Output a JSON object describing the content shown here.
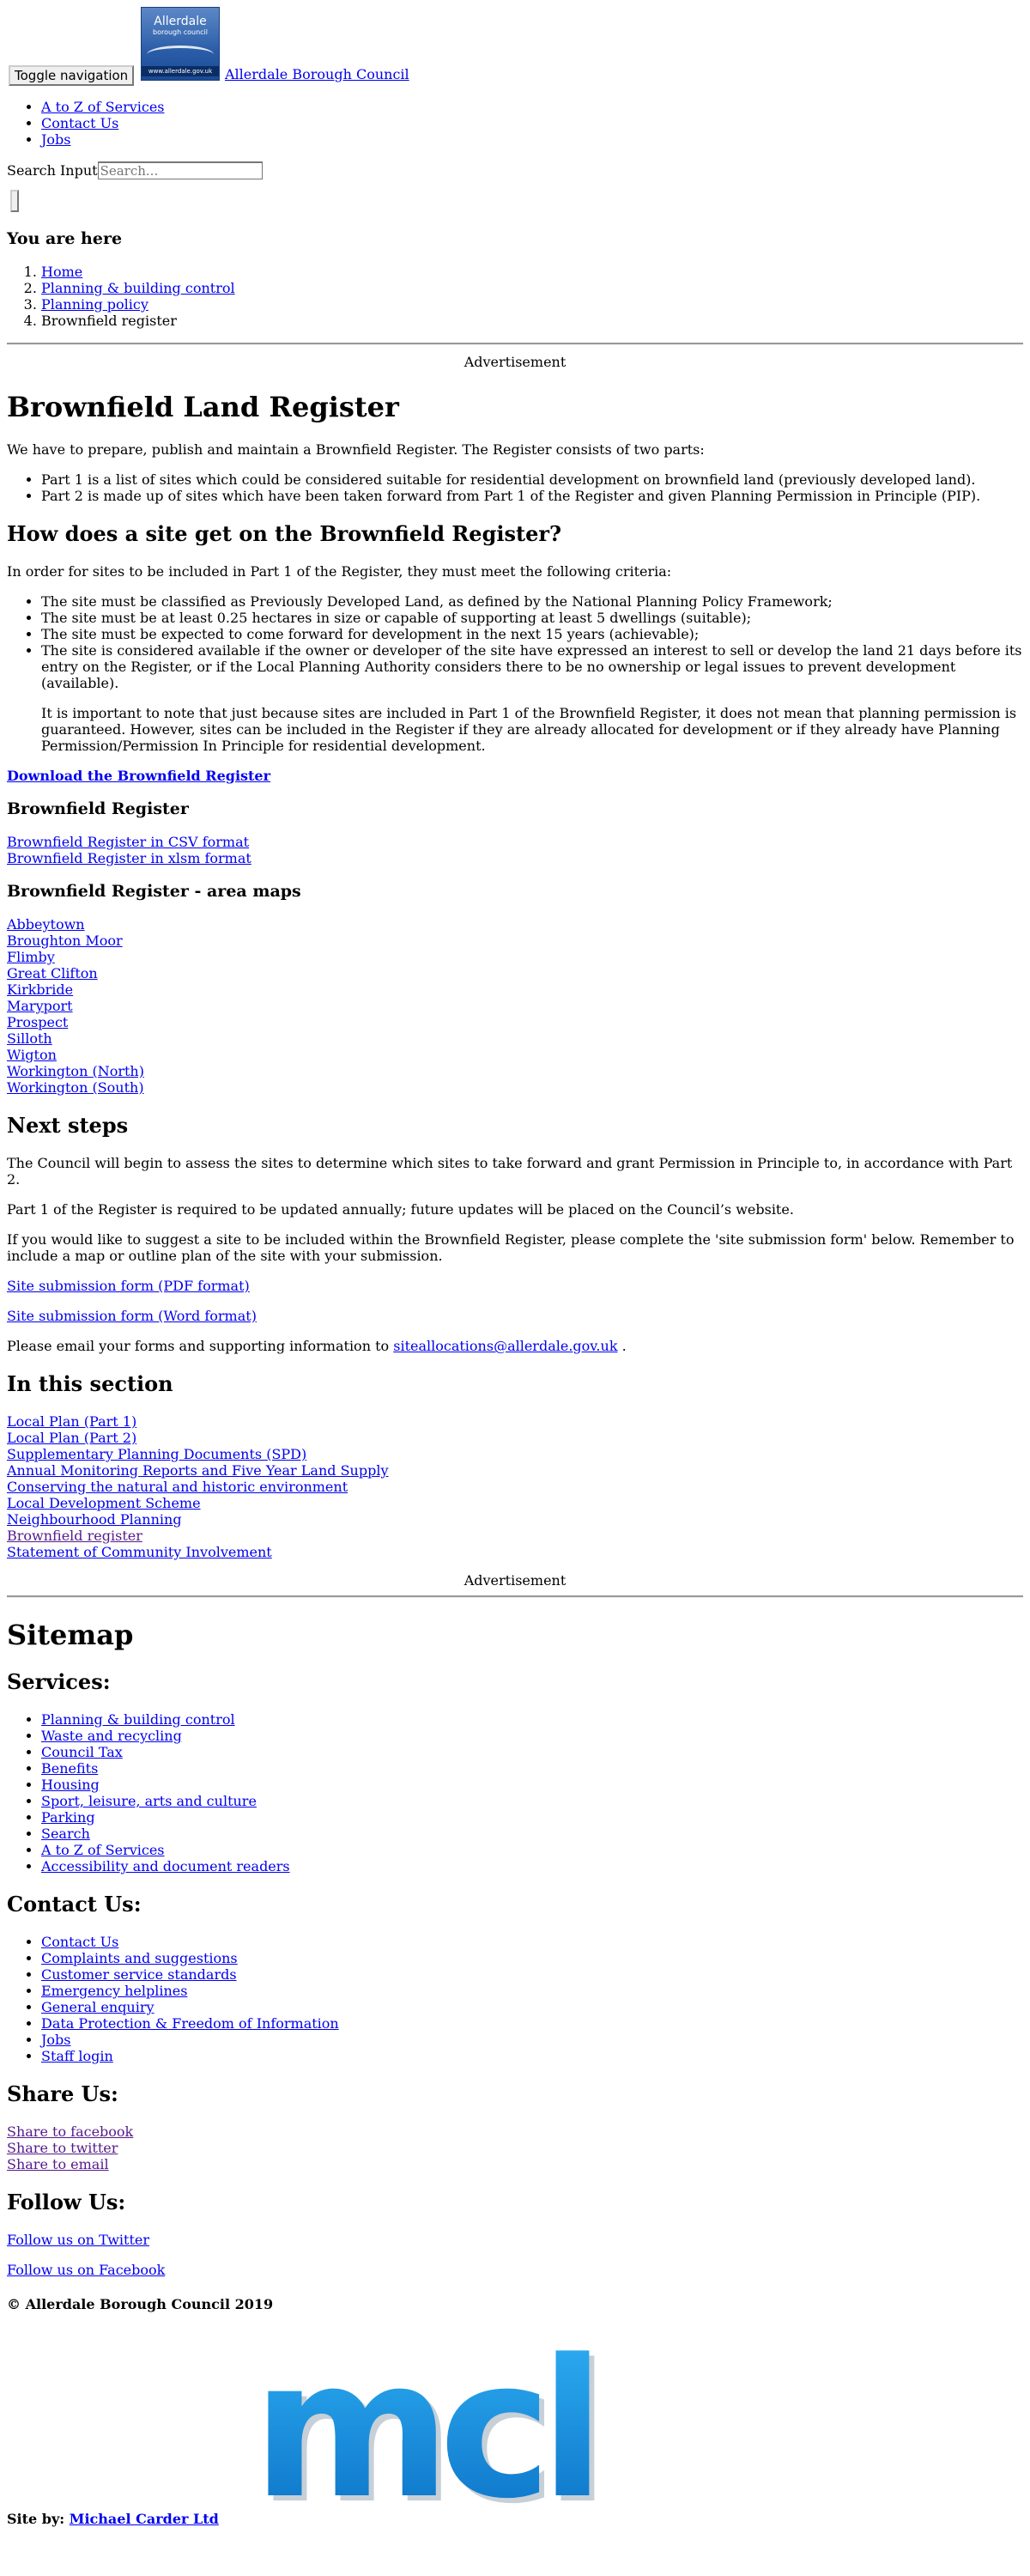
{
  "header": {
    "toggle_label": "Toggle navigation",
    "logo_title": "Allerdale",
    "logo_subtitle": "borough council",
    "logo_url_text": "www.allerdale.gov.uk",
    "brand": "Allerdale Borough Council"
  },
  "topnav": [
    "A to Z of Services",
    "Contact Us",
    "Jobs"
  ],
  "search": {
    "label": "Search Input",
    "placeholder": "Search..."
  },
  "breadcrumb": {
    "heading": "You are here",
    "items": [
      "Home",
      "Planning & building control",
      "Planning policy",
      "Brownfield register"
    ]
  },
  "ad_label": "Advertisement",
  "main": {
    "title": "Brownfield Land Register",
    "intro": "We have to prepare, publish and maintain a Brownfield Register. The Register consists of two parts:",
    "parts": [
      "Part 1 is a list of sites which could be considered suitable for residential development on brownfield land (previously developed land).",
      "Part 2 is made up of sites which have been taken forward from Part 1 of the Register and given Planning Permission in Principle (PIP)."
    ],
    "how_heading": "How does a site get on the Brownfield Register?",
    "how_intro": "In order for sites to be included in Part 1 of the Register, they must meet the following criteria:",
    "criteria": [
      "The site must be classified as Previously Developed Land, as defined by the National Planning Policy Framework;",
      "The site must be at least 0.25 hectares in size or capable of supporting at least 5 dwellings (suitable);",
      "The site must be expected to come forward for development in the next 15 years (achievable);",
      "The site is considered available if the owner or developer of the site have expressed an interest to sell or develop the land 21 days before its entry on the Register, or if the Local Planning Authority considers there to be no ownership or legal issues to prevent development (available)."
    ],
    "note": "It is important to note that just because sites are included in Part 1 of the Brownfield Register, it does not mean that planning permission is guaranteed. However, sites can be included in the Register if they are already allocated for development or if they already have Planning Permission/Permission In Principle for residential development.",
    "download_link": "Download the Brownfield Register",
    "register_heading": "Brownfield Register",
    "register_links": [
      "Brownfield Register in CSV format",
      "Brownfield Register in xlsm format"
    ],
    "maps_heading": "Brownfield Register - area maps",
    "maps": [
      "Abbeytown",
      "Broughton Moor",
      "Flimby",
      "Great Clifton",
      "Kirkbride",
      "Maryport",
      "Prospect",
      "Silloth",
      "Wigton",
      "Workington (North)",
      "Workington (South)"
    ],
    "next_heading": "Next steps",
    "next_p1": "The Council will begin to assess the sites to determine which sites to take forward and grant Permission in Principle to, in accordance with Part 2.",
    "next_p2": "Part 1 of the Register is required to be updated annually; future updates will be placed on the Council’s website.",
    "next_p3": "If you would like to suggest a site to be included within the Brownfield Register, please complete the 'site submission form' below. Remember to include a map or outline plan of the site with your submission.",
    "form_pdf": "Site submission form (PDF format)",
    "form_word": "Site submission form (Word format)",
    "email_text": "Please email your forms and supporting information to",
    "email_link": "siteallocations@allerdale.gov.uk",
    "email_after": "."
  },
  "section": {
    "heading": "In this section",
    "items": [
      "Local Plan (Part 1)",
      "Local Plan (Part 2)",
      "Supplementary Planning Documents (SPD)",
      "Annual Monitoring Reports and Five Year Land Supply",
      "Conserving the natural and historic environment",
      "Local Development Scheme",
      "Neighbourhood Planning",
      "Brownfield register",
      "Statement of Community Involvement"
    ]
  },
  "sitemap": {
    "title": "Sitemap",
    "services_heading": "Services:",
    "services": [
      "Planning & building control",
      "Waste and recycling",
      "Council Tax",
      "Benefits",
      "Housing",
      "Sport, leisure, arts and culture",
      "Parking",
      "Search",
      "A to Z of Services",
      "Accessibility and document readers"
    ],
    "contact_heading": "Contact Us:",
    "contact": [
      "Contact Us",
      "Complaints and suggestions",
      "Customer service standards",
      "Emergency helplines",
      "General enquiry",
      "Data Protection & Freedom of Information",
      "Jobs",
      "Staff login"
    ],
    "share_heading": "Share Us:",
    "share": [
      "Share to facebook",
      "Share to twitter",
      "Share to email"
    ],
    "follow_heading": "Follow Us:",
    "follow": [
      "Follow us on Twitter",
      "Follow us on Facebook"
    ],
    "copyright": "© Allerdale Borough Council 2019",
    "mcl_logo_text": "mcl",
    "site_by_label": "Site by:",
    "site_by_link": "Michael Carder Ltd"
  },
  "colors": {
    "link": "#0000ee",
    "visited": "#551a8b",
    "logo_blue": "#2a5da8",
    "mcl_blue": "#0a8fe0"
  }
}
